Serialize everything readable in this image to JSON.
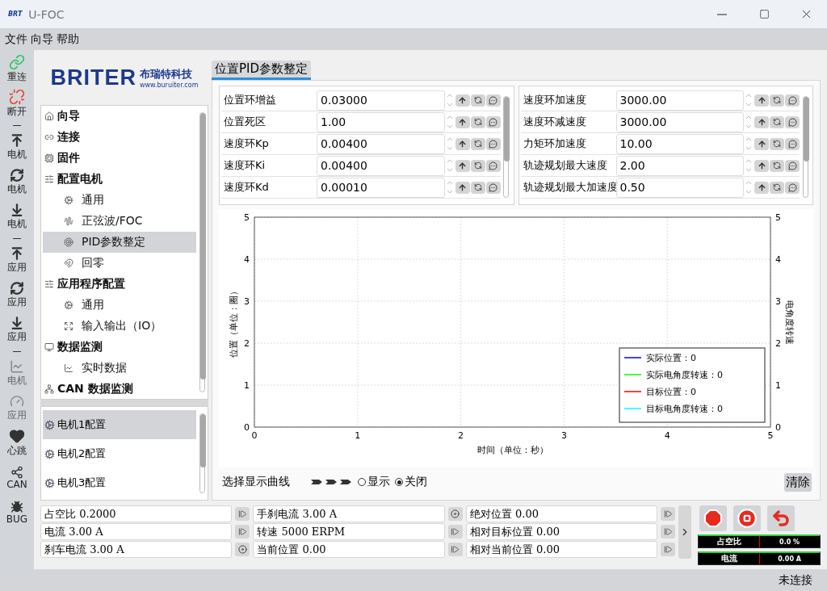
{
  "window": {
    "logo": "BRT",
    "title": "U-FOC"
  },
  "menu": [
    "文件",
    "向导",
    "帮助"
  ],
  "toolbar": [
    {
      "kind": "connect",
      "label": "重连",
      "disabled": false
    },
    {
      "kind": "disconnect",
      "label": "断开",
      "disabled": false
    },
    {
      "kind": "separator"
    },
    {
      "kind": "upload",
      "label": "电机",
      "disabled": false
    },
    {
      "kind": "sync",
      "label": "电机",
      "disabled": false
    },
    {
      "kind": "download",
      "label": "电机",
      "disabled": false
    },
    {
      "kind": "separator"
    },
    {
      "kind": "upload",
      "label": "应用",
      "disabled": false
    },
    {
      "kind": "sync",
      "label": "应用",
      "disabled": false
    },
    {
      "kind": "download",
      "label": "应用",
      "disabled": false
    },
    {
      "kind": "separator"
    },
    {
      "kind": "chart",
      "label": "电机",
      "disabled": true
    },
    {
      "kind": "gauge",
      "label": "应用",
      "disabled": true
    },
    {
      "kind": "heartbeat",
      "label": "心跳",
      "disabled": false
    },
    {
      "kind": "can",
      "label": "CAN",
      "disabled": false
    },
    {
      "kind": "bug",
      "label": "BUG",
      "disabled": false
    }
  ],
  "brand": {
    "name": "BRITER",
    "company": "布瑞特科技",
    "url": "www.buruiter.com"
  },
  "nav": [
    {
      "label": "向导",
      "selected": false
    },
    {
      "label": "连接",
      "selected": false
    },
    {
      "label": "固件",
      "selected": false
    },
    {
      "label": "配置电机",
      "selected": false,
      "children": [
        {
          "label": "通用",
          "selected": false
        },
        {
          "label": "正弦波/FOC",
          "selected": false
        },
        {
          "label": "PID参数整定",
          "selected": true
        },
        {
          "label": "回零",
          "selected": false
        }
      ]
    },
    {
      "label": "应用程序配置",
      "selected": false,
      "children": [
        {
          "label": "通用",
          "selected": false
        },
        {
          "label": "输入输出（IO）",
          "selected": false
        }
      ]
    },
    {
      "label": "数据监测",
      "selected": false,
      "children": [
        {
          "label": "实时数据",
          "selected": false
        }
      ]
    },
    {
      "label": "CAN 数据监测",
      "selected": false
    }
  ],
  "motors": [
    {
      "label": "电机1配置",
      "selected": true
    },
    {
      "label": "电机2配置",
      "selected": false
    },
    {
      "label": "电机3配置",
      "selected": false
    }
  ],
  "tab": {
    "label": "位置PID参数整定",
    "selected": true
  },
  "params": [
    [
      {
        "label": "位置环增益",
        "value": "0.03000"
      },
      {
        "label": "位置死区",
        "value": "1.00"
      },
      {
        "label": "速度环Kp",
        "value": "0.00400"
      },
      {
        "label": "速度环Ki",
        "value": "0.00400"
      },
      {
        "label": "速度环Kd",
        "value": "0.00010"
      }
    ],
    [
      {
        "label": "速度环加速度",
        "value": "3000.00"
      },
      {
        "label": "速度环减速度",
        "value": "3000.00"
      },
      {
        "label": "力矩环加速度",
        "value": "10.00"
      },
      {
        "label": "轨迹规划最大速度",
        "value": "2.00"
      },
      {
        "label": "轨迹规划最大加速度",
        "value": "0.50"
      }
    ]
  ],
  "chart": {
    "chart_data": {
      "type": "line",
      "xlabel": "时间（单位：秒）",
      "ylabel": "位置（单位：圈）",
      "y2label": "电角度转速",
      "categories": [
        "0",
        "1",
        "2",
        "3",
        "4",
        "5"
      ],
      "ylim": [
        0,
        5
      ],
      "yticks": [
        0,
        1,
        2,
        3,
        4,
        5
      ],
      "y2lim": [
        0,
        5
      ],
      "y2ticks": [
        0,
        1,
        2,
        3,
        4,
        5
      ],
      "grid": true,
      "series": [
        {
          "name": "实际位置：0",
          "color": "#0000ff",
          "values": [
            null,
            null,
            null,
            null,
            null,
            null
          ]
        },
        {
          "name": "实际电角度转速：0",
          "color": "#00ff00",
          "values": [
            null,
            null,
            null,
            null,
            null,
            null
          ]
        },
        {
          "name": "目标位置：0",
          "color": "#ff0000",
          "values": [
            null,
            null,
            null,
            null,
            null,
            null
          ]
        },
        {
          "name": "目标电角度转速：0",
          "color": "#00ffff",
          "values": [
            null,
            null,
            null,
            null,
            null,
            null
          ]
        }
      ]
    }
  },
  "curve_select": {
    "label": "选择显示曲线",
    "options": [
      {
        "label": "显示",
        "selected": false
      },
      {
        "label": "关闭",
        "selected": true
      }
    ],
    "clear": "清除"
  },
  "readouts": [
    [
      {
        "text": "占空比 0.2000",
        "kind": "step"
      },
      {
        "text": "电流 3.00 A",
        "kind": "step"
      },
      {
        "text": "刹车电流 3.00 A",
        "kind": "toggle"
      }
    ],
    [
      {
        "text": "手刹电流 3.00 A",
        "kind": "toggle"
      },
      {
        "text": "转速 5000 ERPM",
        "kind": "step"
      },
      {
        "text": "当前位置 0.00",
        "kind": "step"
      }
    ],
    [
      {
        "text": "绝对位置 0.00",
        "kind": "step"
      },
      {
        "text": "相对目标位置 0.00",
        "kind": "step"
      },
      {
        "text": "相对当前位置 0.00",
        "kind": "step"
      }
    ]
  ],
  "meters": [
    {
      "label": "占空比",
      "reading": "0.0 %"
    },
    {
      "label": "电流",
      "reading": "0.00 A"
    }
  ],
  "status": "未连接"
}
